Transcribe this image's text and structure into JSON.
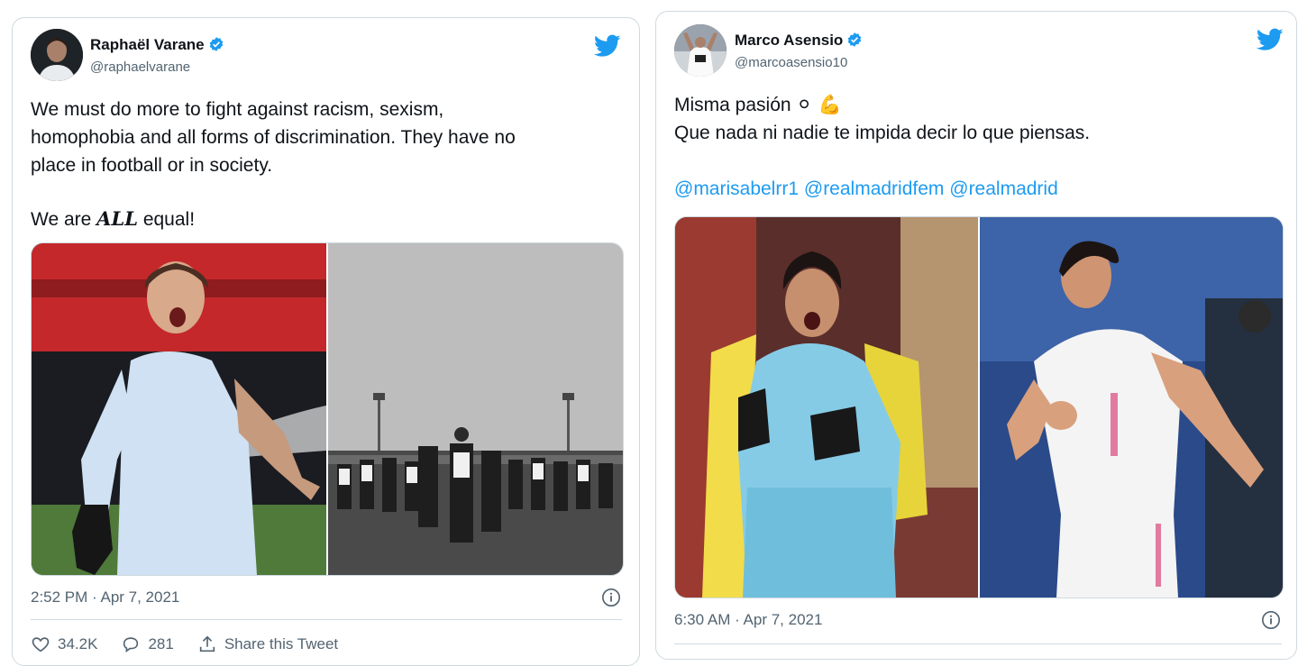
{
  "tweet1": {
    "author_name": "Raphaël Varane",
    "author_handle": "@raphaelvarane",
    "text_lines": [
      "We must do more to fight against racism, sexism,",
      "homophobia and all forms of discrimination. They have no",
      "place in football or in society."
    ],
    "equal_prefix": "We are ",
    "equal_emph": "𝑨𝑳𝑳",
    "equal_suffix": " equal!",
    "timestamp": "2:52 PM · Apr 7, 2021",
    "likes": "34.2K",
    "replies": "281",
    "share_label": "Share this Tweet",
    "icons": [
      "verified-badge-icon",
      "twitter-bird-icon",
      "info-icon",
      "heart-icon",
      "reply-icon",
      "share-icon"
    ]
  },
  "tweet2": {
    "author_name": "Marco Asensio",
    "author_handle": "@marcoasensio10",
    "line1": "Misma pasión",
    "line1_emoji": "⚪ 💪",
    "line2": "Que nada ni nadie te impida decir lo que piensas.",
    "mentions": [
      "@marisabelrr1",
      "@realmadridfem",
      "@realmadrid"
    ],
    "timestamp": "6:30 AM · Apr 7, 2021",
    "icons": [
      "verified-badge-icon",
      "twitter-bird-icon",
      "info-icon"
    ]
  },
  "colors": {
    "accent": "#1d9bf0",
    "secondary_text": "#536471",
    "border": "#cfd9de"
  }
}
